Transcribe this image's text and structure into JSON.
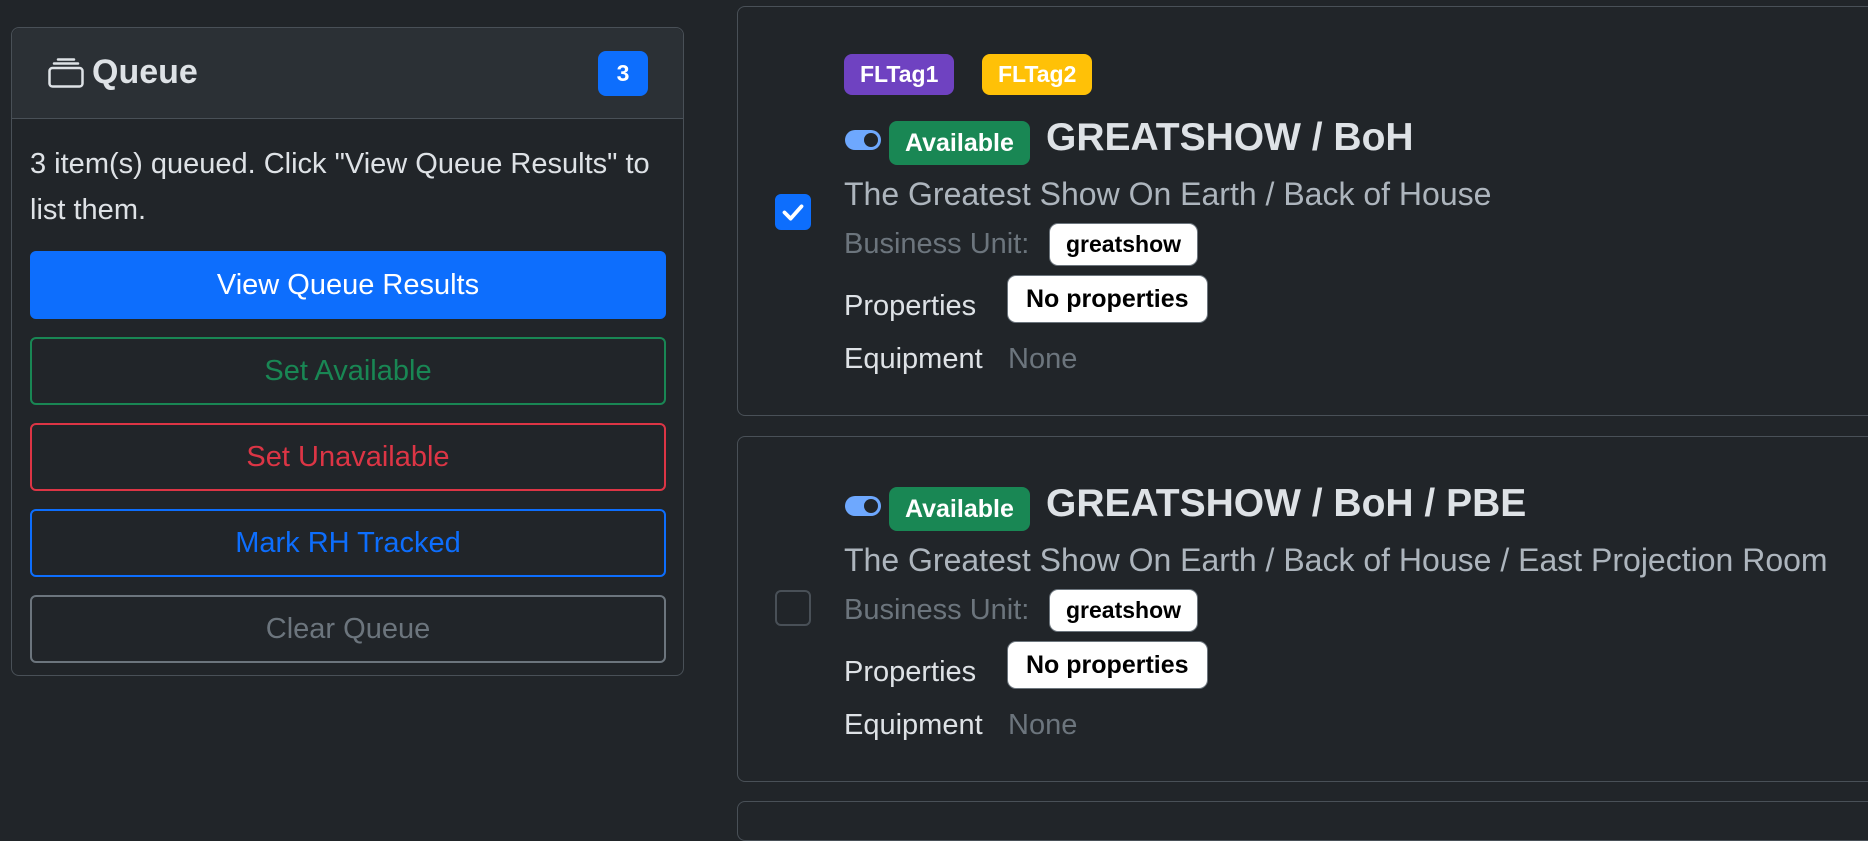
{
  "queue": {
    "title": "Queue",
    "count": "3",
    "message": "3 item(s) queued. Click \"View Queue Results\" to list them.",
    "buttons": {
      "view_results": "View Queue Results",
      "set_available": "Set Available",
      "set_unavailable": "Set Unavailable",
      "mark_rh_tracked": "Mark RH Tracked",
      "clear_queue": "Clear Queue"
    }
  },
  "locations": [
    {
      "checked": true,
      "tags": [
        "FLTag1",
        "FLTag2"
      ],
      "status": "Available",
      "name": "GREATSHOW / BoH",
      "description": "The Greatest Show On Earth / Back of House",
      "business_unit_label": "Business Unit:",
      "business_unit": "greatshow",
      "properties_label": "Properties",
      "properties": "No properties",
      "equipment_label": "Equipment",
      "equipment": "None"
    },
    {
      "checked": false,
      "tags": [],
      "status": "Available",
      "name": "GREATSHOW / BoH / PBE",
      "description": "The Greatest Show On Earth / Back of House / East Projection Room",
      "business_unit_label": "Business Unit:",
      "business_unit": "greatshow",
      "properties_label": "Properties",
      "properties": "No properties",
      "equipment_label": "Equipment",
      "equipment": "None"
    }
  ],
  "colors": {
    "background": "#212529",
    "primary": "#0d6efd",
    "success": "#198754",
    "danger": "#dc3545",
    "secondary": "#6c757d",
    "tag1": "#6f42c1",
    "tag2": "#ffc107"
  },
  "icons": {
    "queue": "collection-icon",
    "checkbox_check": "check-icon",
    "toggle": "toggle-on-icon"
  }
}
